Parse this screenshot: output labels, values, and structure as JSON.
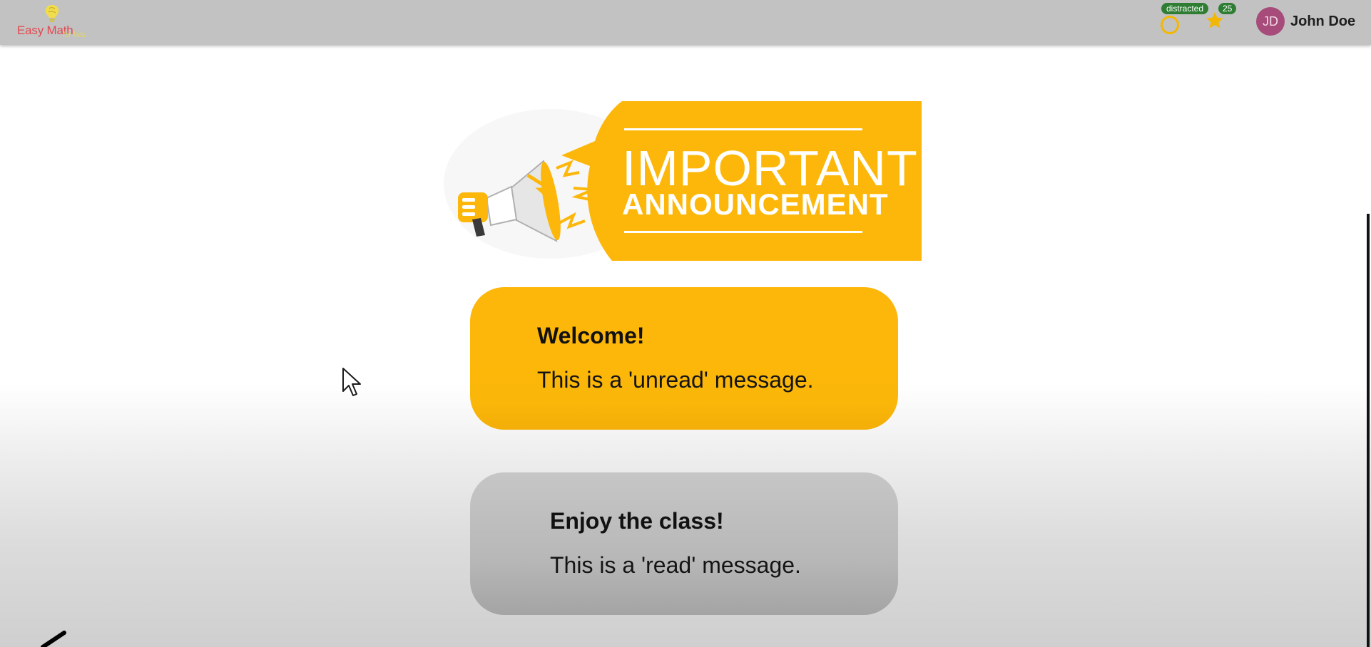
{
  "header": {
    "logo_text": "Easy Math",
    "logo_subtext": "for kids",
    "status_badge": "distracted",
    "points_badge": "25",
    "avatar_initials": "JD",
    "user_name": "John Doe"
  },
  "banner": {
    "line1": "IMPORTANT",
    "line2": "ANNOUNCEMENT"
  },
  "messages": [
    {
      "title": "Welcome!",
      "body": "This is a 'unread' message.",
      "state": "unread"
    },
    {
      "title": "Enjoy the class!",
      "body": "This is a 'read' message.",
      "state": "read"
    }
  ],
  "colors": {
    "topbar": "#c2c2c2",
    "accent": "#fdb70a",
    "read_card": "#b8b8b8",
    "badge_green": "#2e7d32",
    "avatar": "#a64b7a"
  },
  "icons": [
    "brain-lightbulb-logo-icon",
    "status-circle-icon",
    "star-icon",
    "megaphone-icon",
    "mouse-cursor-icon",
    "pen-icon"
  ]
}
